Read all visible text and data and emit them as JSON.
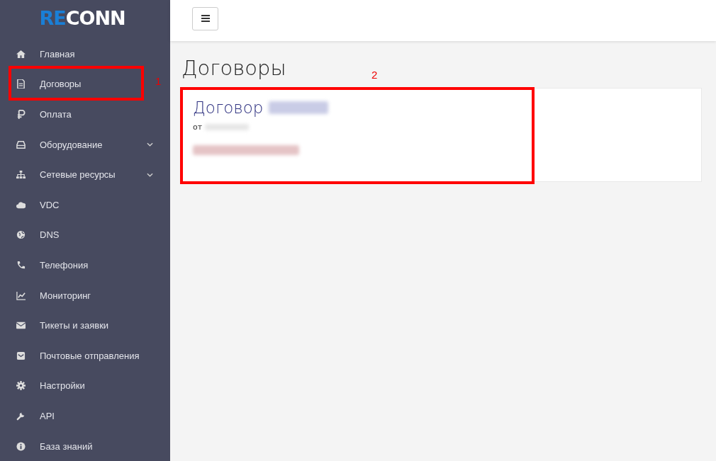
{
  "logo": {
    "parts": [
      {
        "text": "RE",
        "color": "#1a7fd6"
      },
      {
        "text": "CONN",
        "color": "#ffffff"
      }
    ]
  },
  "sidebar": {
    "items": [
      {
        "label": "Главная",
        "expandable": false
      },
      {
        "label": "Договоры",
        "expandable": false
      },
      {
        "label": "Оплата",
        "expandable": false
      },
      {
        "label": "Оборудование",
        "expandable": true
      },
      {
        "label": "Сетевые ресурсы",
        "expandable": true
      },
      {
        "label": "VDC",
        "expandable": false
      },
      {
        "label": "DNS",
        "expandable": false
      },
      {
        "label": "Телефония",
        "expandable": false
      },
      {
        "label": "Мониторинг",
        "expandable": false
      },
      {
        "label": "Тикеты и заявки",
        "expandable": false
      },
      {
        "label": "Почтовые отправления",
        "expandable": false
      },
      {
        "label": "Настройки",
        "expandable": false
      },
      {
        "label": "API",
        "expandable": false
      },
      {
        "label": "База знаний",
        "expandable": false
      }
    ]
  },
  "page": {
    "title": "Договоры",
    "contract_card": {
      "title": "Договор",
      "date_prefix": "от"
    }
  },
  "annotations": [
    {
      "label": "1"
    },
    {
      "label": "2"
    }
  ]
}
